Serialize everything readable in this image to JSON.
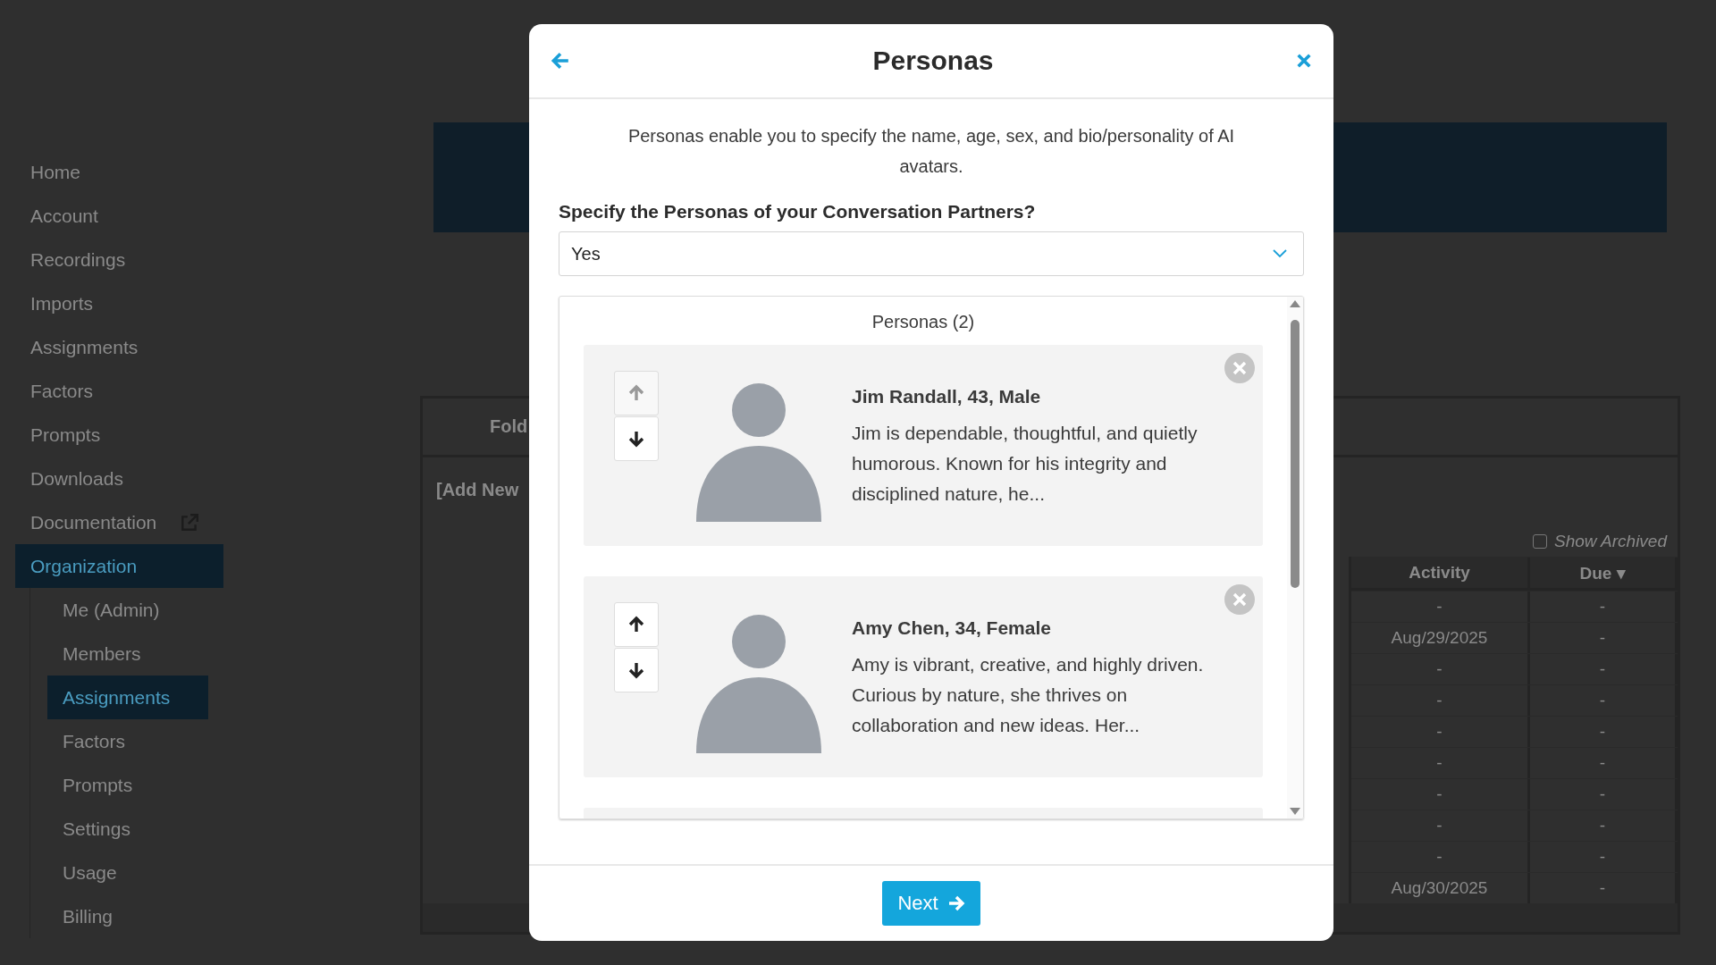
{
  "sidebar": {
    "items": [
      {
        "label": "Home",
        "selected": false,
        "kind": "plain"
      },
      {
        "label": "Account",
        "selected": false,
        "kind": "plain"
      },
      {
        "label": "Recordings",
        "selected": false,
        "kind": "plain"
      },
      {
        "label": "Imports",
        "selected": false,
        "kind": "plain"
      },
      {
        "label": "Assignments",
        "selected": false,
        "kind": "plain"
      },
      {
        "label": "Factors",
        "selected": false,
        "kind": "plain"
      },
      {
        "label": "Prompts",
        "selected": false,
        "kind": "plain"
      },
      {
        "label": "Downloads",
        "selected": false,
        "kind": "plain"
      },
      {
        "label": "Documentation",
        "selected": false,
        "kind": "external"
      },
      {
        "label": "Organization",
        "selected": true,
        "kind": "plain",
        "children": [
          {
            "label": "Me (Admin)",
            "selected": false
          },
          {
            "label": "Members",
            "selected": false
          },
          {
            "label": "Assignments",
            "selected": true
          },
          {
            "label": "Factors",
            "selected": false
          },
          {
            "label": "Prompts",
            "selected": false
          },
          {
            "label": "Settings",
            "selected": false
          },
          {
            "label": "Usage",
            "selected": false
          },
          {
            "label": "Billing",
            "selected": false
          }
        ]
      }
    ]
  },
  "background_table": {
    "header": "Fold",
    "add_row": "[Add New",
    "show_archived": {
      "label": "Show Archived",
      "checked": false
    },
    "columns": [
      "Activity",
      "Due ▾"
    ],
    "rows": [
      [
        "-",
        "-"
      ],
      [
        "Aug/29/2025",
        "-"
      ],
      [
        "-",
        "-"
      ],
      [
        "-",
        "-"
      ],
      [
        "-",
        "-"
      ],
      [
        "-",
        "-"
      ],
      [
        "-",
        "-"
      ],
      [
        "-",
        "-"
      ],
      [
        "-",
        "-"
      ],
      [
        "Aug/30/2025",
        "-"
      ]
    ]
  },
  "modal": {
    "title": "Personas",
    "description": "Personas enable you to specify the name, age, sex, and bio/personality of AI avatars.",
    "question": "Specify the Personas of your Conversation Partners?",
    "answer": "Yes",
    "list_title": "Personas (2)",
    "personas": [
      {
        "heading": "Jim Randall, 43, Male",
        "bio": "Jim is dependable, thoughtful, and quietly humorous. Known for his integrity and disciplined nature, he...",
        "up_disabled": true,
        "down_disabled": false
      },
      {
        "heading": "Amy Chen, 34, Female",
        "bio": "Amy is vibrant, creative, and highly driven. Curious by nature, she thrives on collaboration and new ideas. Her...",
        "up_disabled": false,
        "down_disabled": false
      }
    ],
    "next_button": "Next"
  }
}
